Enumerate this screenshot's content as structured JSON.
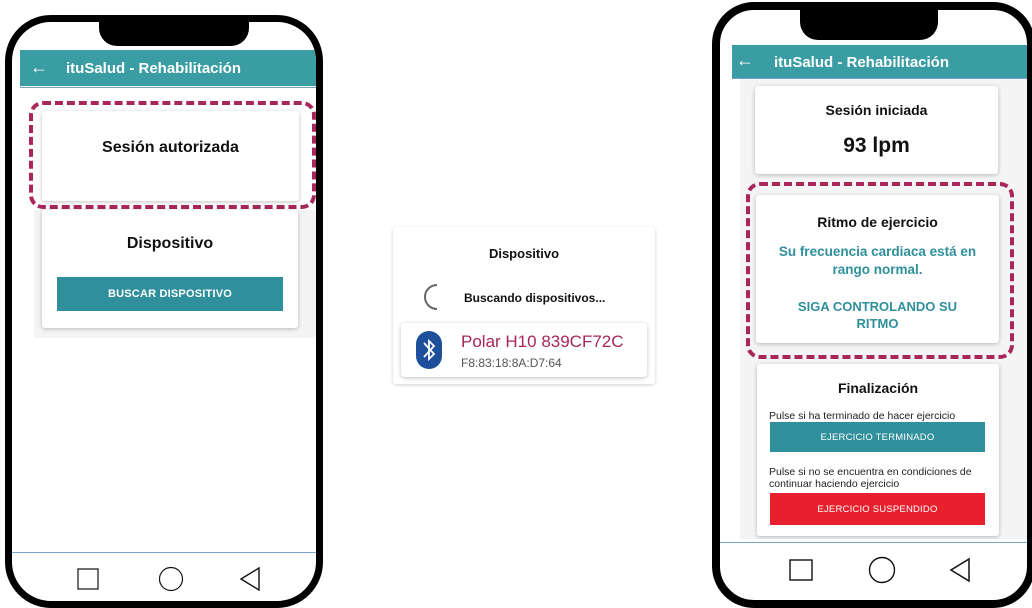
{
  "app": {
    "title": "ituSalud - Rehabilitación",
    "back_icon": "arrow-left-icon",
    "bar_color": "#3a9da4",
    "accent_color": "#2f8f9b",
    "highlight_color": "#a8265a",
    "danger_color": "#e8202d"
  },
  "left_screen": {
    "session_card": {
      "title": "Sesión autorizada"
    },
    "device_card": {
      "title": "Dispositivo",
      "button_label": "BUSCAR DISPOSITIVO"
    }
  },
  "middle_panel": {
    "title": "Dispositivo",
    "searching_text": "Buscando dispositivos...",
    "device": {
      "name": "Polar H10 839CF72C",
      "address": "F8:83:18:8A:D7:64",
      "icon": "bluetooth-icon"
    }
  },
  "right_screen": {
    "session_card": {
      "title": "Sesión iniciada",
      "heart_rate": "93 lpm"
    },
    "rhythm_card": {
      "title": "Ritmo de ejercicio",
      "message": "Su frecuencia cardiaca está en rango normal.",
      "advice": "SIGA CONTROLANDO SU RITMO"
    },
    "finish_card": {
      "title": "Finalización",
      "done_hint": "Pulse si ha terminado de hacer ejercicio",
      "done_button": "EJERCICIO TERMINADO",
      "suspend_hint": "Pulse si no se encuentra en condiciones de continuar haciendo ejercicio",
      "suspend_button": "EJERCICIO SUSPENDIDO"
    }
  },
  "nav_bar": {
    "items": [
      "square-icon",
      "circle-icon",
      "triangle-back-icon"
    ]
  }
}
